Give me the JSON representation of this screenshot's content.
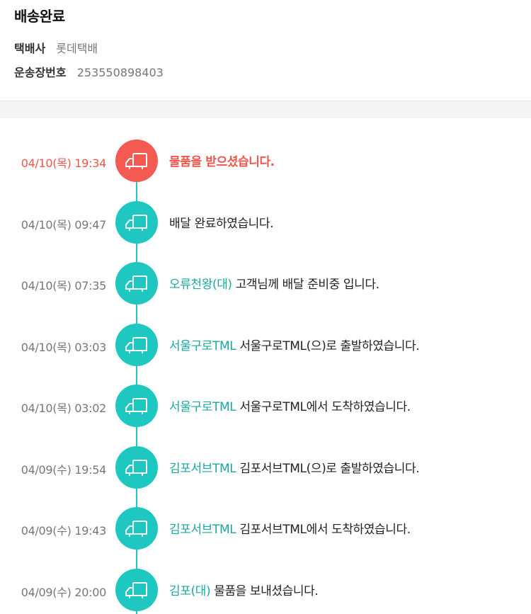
{
  "header": {
    "status": "배송완료",
    "courier_label": "택배사",
    "courier_value": "롯데택배",
    "tracking_label": "운송장번호",
    "tracking_value": "253550898403"
  },
  "colors": {
    "accent": "#1ec8c0",
    "active": "#f25a52",
    "location_text": "#1aa8a1"
  },
  "events": [
    {
      "time": "04/10(목) 19:34",
      "location": "",
      "message": "물품을 받으셨습니다.",
      "active": true,
      "icon": "truck-icon"
    },
    {
      "time": "04/10(목) 09:47",
      "location": "",
      "message": "배달 완료하였습니다.",
      "active": false,
      "icon": "truck-icon"
    },
    {
      "time": "04/10(목) 07:35",
      "location": "오류천왕(대)",
      "message": "고객님께 배달 준비중 입니다.",
      "active": false,
      "icon": "truck-icon"
    },
    {
      "time": "04/10(목) 03:03",
      "location": "서울구로TML",
      "message": "서울구로TML(으)로 출발하였습니다.",
      "active": false,
      "icon": "truck-icon"
    },
    {
      "time": "04/10(목) 03:02",
      "location": "서울구로TML",
      "message": "서울구로TML에서 도착하였습니다.",
      "active": false,
      "icon": "truck-icon"
    },
    {
      "time": "04/09(수) 19:54",
      "location": "김포서브TML",
      "message": "김포서브TML(으)로 출발하였습니다.",
      "active": false,
      "icon": "truck-icon"
    },
    {
      "time": "04/09(수) 19:43",
      "location": "김포서브TML",
      "message": "김포서브TML에서 도착하였습니다.",
      "active": false,
      "icon": "truck-icon"
    },
    {
      "time": "04/09(수) 20:00",
      "location": "김포(대)",
      "message": "물품을 보내셨습니다.",
      "active": false,
      "icon": "truck-icon"
    }
  ]
}
